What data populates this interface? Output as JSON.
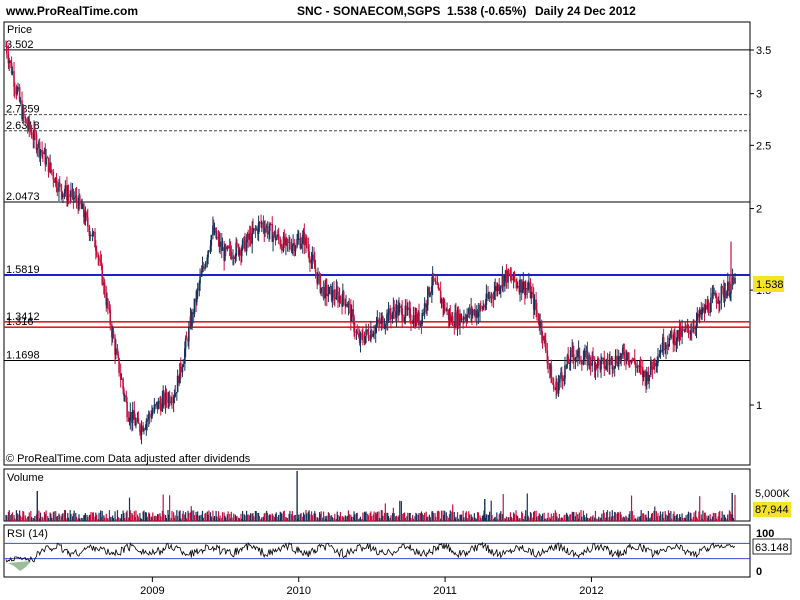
{
  "header": {
    "site": "www.ProRealTime.com",
    "symbol": "SNC - SONAECOM,SGPS",
    "price_change": "1.538 (-0.65%)",
    "period": "Daily  24 Dec 2012"
  },
  "panels": {
    "price_title": "Price",
    "footer_note": "© ProRealTime.com  Data adjusted after dividends",
    "volume_title": "Volume",
    "volume_axis_label": "5,000K",
    "volume_value": "87,944",
    "rsi_title": "RSI (14)",
    "rsi_axis_top": "100",
    "rsi_axis_bottom": "0",
    "rsi_value": "63.148",
    "last_price": "1.538"
  },
  "colors": {
    "up": "#16315a",
    "down": "#c8103e",
    "blue_line": "#1a22c8",
    "red_line": "#e0201a",
    "badge": "#f5e326",
    "rsi_line": "#000000",
    "rsi_band": "#3a4ccf"
  },
  "chart_data": {
    "type": "candlestick",
    "y_axis": {
      "scale": "log",
      "range": [
        0.88,
        3.7
      ],
      "ticks": [
        "3.5",
        "3",
        "2.5",
        "2",
        "1.5",
        "1"
      ]
    },
    "x_axis": {
      "ticks": [
        "2009",
        "2010",
        "2011",
        "2012"
      ]
    },
    "horizontal_levels": [
      {
        "label": "3.502",
        "value": 3.502,
        "style": "solid-black"
      },
      {
        "label": "2.7859",
        "value": 2.7859,
        "style": "dashed-black"
      },
      {
        "label": "2.6318",
        "value": 2.6318,
        "style": "dashed-black"
      },
      {
        "label": "2.0473",
        "value": 2.0473,
        "style": "solid-black"
      },
      {
        "label": "1.5819",
        "value": 1.5819,
        "style": "solid-blue"
      },
      {
        "label": "1.3412",
        "value": 1.3412,
        "style": "solid-red"
      },
      {
        "label": "1.316",
        "value": 1.316,
        "style": "solid-red"
      },
      {
        "label": "1.1698",
        "value": 1.1698,
        "style": "solid-black"
      }
    ],
    "price_path": [
      {
        "date": "2008-01-02",
        "value": 3.55
      },
      {
        "date": "2008-02-15",
        "value": 2.75
      },
      {
        "date": "2008-03-31",
        "value": 2.45
      },
      {
        "date": "2008-05-15",
        "value": 2.15
      },
      {
        "date": "2008-06-30",
        "value": 2.05
      },
      {
        "date": "2008-08-15",
        "value": 1.75
      },
      {
        "date": "2008-09-30",
        "value": 1.22
      },
      {
        "date": "2008-10-31",
        "value": 0.98
      },
      {
        "date": "2008-11-30",
        "value": 0.92
      },
      {
        "date": "2009-01-15",
        "value": 1.0
      },
      {
        "date": "2009-02-28",
        "value": 1.05
      },
      {
        "date": "2009-04-30",
        "value": 1.55
      },
      {
        "date": "2009-05-31",
        "value": 1.85
      },
      {
        "date": "2009-06-30",
        "value": 1.7
      },
      {
        "date": "2009-08-15",
        "value": 1.75
      },
      {
        "date": "2009-09-30",
        "value": 1.9
      },
      {
        "date": "2009-11-30",
        "value": 1.75
      },
      {
        "date": "2010-01-15",
        "value": 1.8
      },
      {
        "date": "2010-02-28",
        "value": 1.5
      },
      {
        "date": "2010-04-30",
        "value": 1.45
      },
      {
        "date": "2010-05-31",
        "value": 1.25
      },
      {
        "date": "2010-06-30",
        "value": 1.3
      },
      {
        "date": "2010-08-31",
        "value": 1.4
      },
      {
        "date": "2010-10-31",
        "value": 1.35
      },
      {
        "date": "2010-11-30",
        "value": 1.55
      },
      {
        "date": "2011-01-15",
        "value": 1.35
      },
      {
        "date": "2011-03-31",
        "value": 1.4
      },
      {
        "date": "2011-05-31",
        "value": 1.58
      },
      {
        "date": "2011-07-31",
        "value": 1.5
      },
      {
        "date": "2011-08-31",
        "value": 1.3
      },
      {
        "date": "2011-09-30",
        "value": 1.05
      },
      {
        "date": "2011-11-15",
        "value": 1.2
      },
      {
        "date": "2012-01-31",
        "value": 1.15
      },
      {
        "date": "2012-03-31",
        "value": 1.2
      },
      {
        "date": "2012-05-15",
        "value": 1.1
      },
      {
        "date": "2012-06-30",
        "value": 1.25
      },
      {
        "date": "2012-08-31",
        "value": 1.3
      },
      {
        "date": "2012-10-31",
        "value": 1.45
      },
      {
        "date": "2012-12-24",
        "value": 1.538
      }
    ],
    "volume": {
      "max_label": "5,000K",
      "last": 87944
    },
    "rsi": {
      "period": 14,
      "last": 63.148,
      "range": [
        0,
        100
      ],
      "bands": [
        70,
        30
      ]
    }
  }
}
